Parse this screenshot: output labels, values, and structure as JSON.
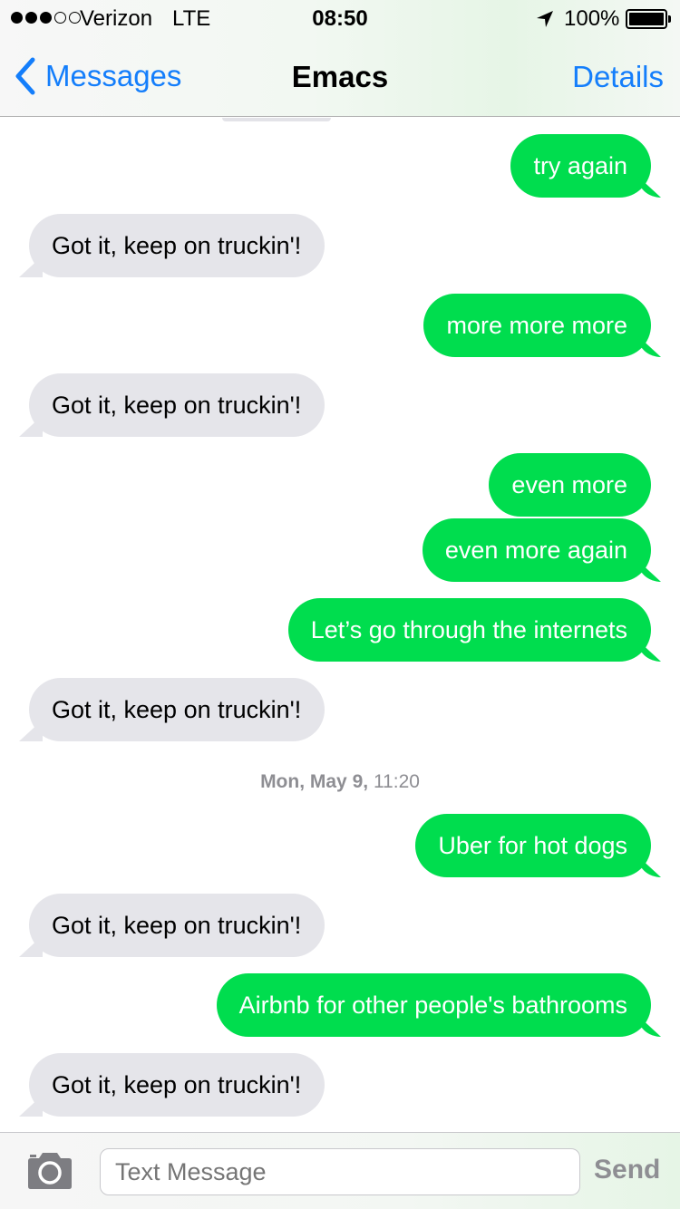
{
  "status_bar": {
    "carrier": "Verizon",
    "network": "LTE",
    "time": "08:50",
    "battery": "100%",
    "signal_bars_filled": 3,
    "signal_bars_total": 5
  },
  "nav": {
    "back_label": "Messages",
    "title": "Emacs",
    "details_label": "Details"
  },
  "messages": [
    {
      "direction": "out",
      "text": "try again"
    },
    {
      "direction": "in",
      "text": "Got it, keep on truckin'!"
    },
    {
      "direction": "out",
      "text": "more more more"
    },
    {
      "direction": "in",
      "text": "Got it, keep on truckin'!"
    },
    {
      "direction": "out",
      "text": "even more"
    },
    {
      "direction": "out",
      "text": "even more again"
    },
    {
      "direction": "out",
      "text": "Let’s go through the internets"
    },
    {
      "direction": "in",
      "text": "Got it, keep on truckin'!"
    },
    {
      "direction": "out",
      "text": "Uber for hot dogs"
    },
    {
      "direction": "in",
      "text": "Got it, keep on truckin'!"
    },
    {
      "direction": "out",
      "text": "Airbnb for other people's bathrooms"
    },
    {
      "direction": "in",
      "text": "Got it, keep on truckin'!"
    }
  ],
  "timestamp": {
    "day": "Mon, May 9,",
    "time": "11:20"
  },
  "compose": {
    "placeholder": "Text Message",
    "send_label": "Send"
  },
  "colors": {
    "accent_blue": "#147efb",
    "outgoing_bubble": "#00dd4e",
    "incoming_bubble": "#e5e5ea"
  },
  "icons": [
    "location-arrow-icon",
    "battery-icon",
    "chevron-left-icon",
    "camera-icon"
  ]
}
